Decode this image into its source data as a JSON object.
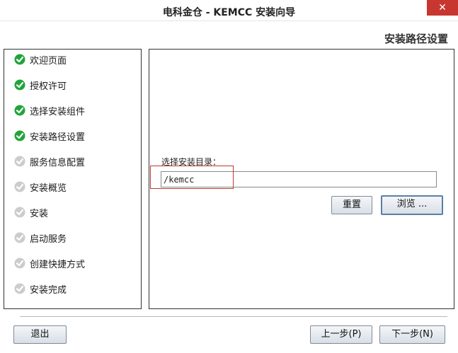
{
  "window": {
    "title": "电科金仓 - KEMCC 安装向导",
    "close_glyph": "✕"
  },
  "page_heading": "安装路径设置",
  "steps": [
    {
      "label": "欢迎页面",
      "state": "done"
    },
    {
      "label": "授权许可",
      "state": "done"
    },
    {
      "label": "选择安装组件",
      "state": "done"
    },
    {
      "label": "安装路径设置",
      "state": "done"
    },
    {
      "label": "服务信息配置",
      "state": "pending"
    },
    {
      "label": "安装概览",
      "state": "pending"
    },
    {
      "label": "安装",
      "state": "pending"
    },
    {
      "label": "启动服务",
      "state": "pending"
    },
    {
      "label": "创建快捷方式",
      "state": "pending"
    },
    {
      "label": "安装完成",
      "state": "pending"
    }
  ],
  "install_dir": {
    "label": "选择安装目录：",
    "value": "/kemcc"
  },
  "buttons": {
    "reset": "重置",
    "browse": "浏览 ...",
    "exit": "退出",
    "prev": "上一步(P)",
    "next": "下一步(N)"
  },
  "colors": {
    "done": "#22a43a",
    "pending": "#cccccc",
    "close": "#c7372f",
    "highlight": "#c0392b"
  }
}
